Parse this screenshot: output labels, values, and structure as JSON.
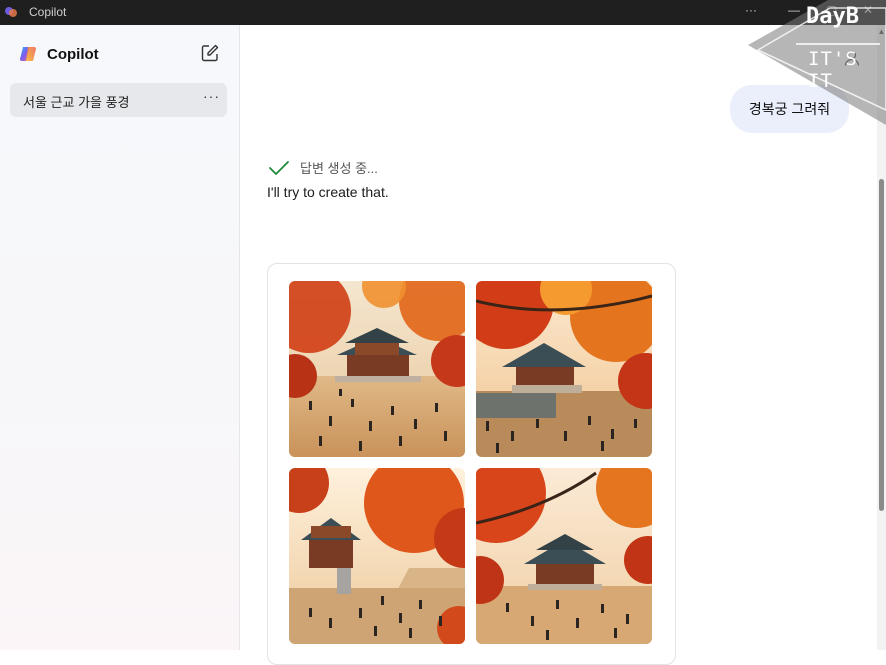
{
  "window": {
    "title": "Copilot",
    "more_label": "···",
    "minimize_label": "—",
    "maximize_label": "▢",
    "close_label": "✕"
  },
  "sidebar": {
    "brand_name": "Copilot",
    "conversations": [
      {
        "label": "서울 근교 가을 풍경",
        "more_label": "···"
      }
    ]
  },
  "chat": {
    "user_message": "경복궁 그려줘",
    "status_text": "답변 생성 중...",
    "reply_text": "I'll try to create that.",
    "images": [
      {
        "name": "generated-image-1",
        "subject": "gyeongbokgung-autumn"
      },
      {
        "name": "generated-image-2",
        "subject": "gyeongbokgung-autumn"
      },
      {
        "name": "generated-image-3",
        "subject": "gyeongbokgung-autumn"
      },
      {
        "name": "generated-image-4",
        "subject": "gyeongbokgung-autumn"
      }
    ]
  },
  "watermark": {
    "line1": "DayB",
    "line2": "IT'S IT"
  },
  "colors": {
    "accent_check": "#1e8a3a",
    "user_bubble": "#ebeffc",
    "titlebar": "#1f1f1f"
  }
}
